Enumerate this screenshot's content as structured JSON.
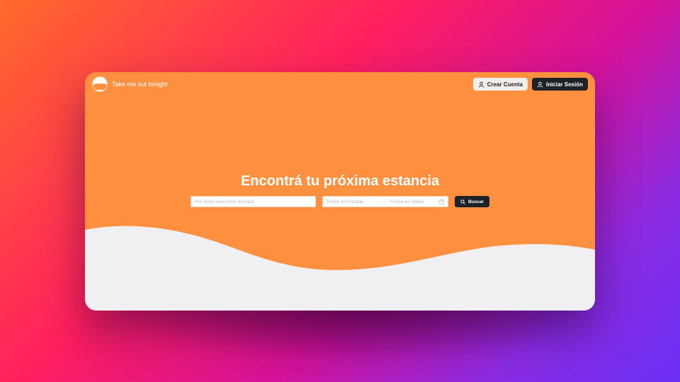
{
  "header": {
    "brand_name": "Take me out tonight",
    "create_account_label": "Crear Cuenta",
    "login_label": "Iniciar Sesión"
  },
  "hero": {
    "title": "Encontrá tu próxima estancia"
  },
  "search": {
    "place_placeholder": "Por favor seleccione un lugar",
    "checkin_placeholder": "Fecha de Entrada",
    "checkout_placeholder": "Fecha de Salida",
    "button_label": "Buscar"
  },
  "icons": {
    "user": "user-icon",
    "calendar": "calendar-icon",
    "search": "search-icon",
    "arrow": "arrow-right-icon"
  },
  "colors": {
    "brand_orange": "#ff9040",
    "dark_button": "#1f2327",
    "light_button": "#f1eeec",
    "wave": "#f0f0f2"
  }
}
